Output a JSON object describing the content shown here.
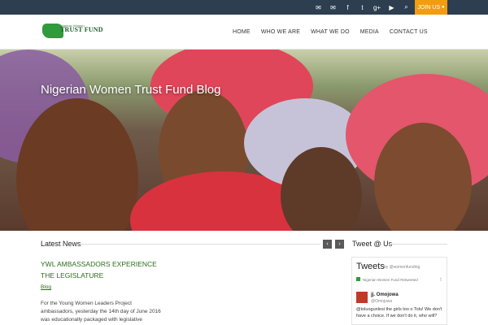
{
  "topbar": {
    "icons": [
      "envelope-icon",
      "envelope-icon",
      "facebook-icon",
      "twitter-icon",
      "googleplus-icon",
      "youtube-icon",
      "search-icon"
    ],
    "join_label": "JOIN US"
  },
  "header": {
    "logo_name": "TRUST FUND",
    "logo_sub": "Nigerian Women",
    "nav": [
      "HOME",
      "WHO WE ARE",
      "WHAT WE DO",
      "MEDIA",
      "CONTACT US"
    ]
  },
  "hero": {
    "title": "Nigerian Women Trust Fund Blog"
  },
  "news": {
    "title": "Latest News",
    "post_title": "YWL AMBASSADORS EXPERIENCE THE LEGISLATURE",
    "post_category": "Blog",
    "post_excerpt": "For the Young Women Leaders Project ambassadors, yesterday the 14th day of June 2016 was educationally packaged with legislative"
  },
  "tweets": {
    "section_title": "Tweet @ Us",
    "widget_title": "Tweets",
    "by": "by @womenfunding",
    "retweeted": "Nigerian Women Fund Retweeted",
    "user_name": "jj. Omojowa",
    "user_handle": "@Omojuwa",
    "text": "@toluogunlesi the girls too o Tolu! We don't have a choice. If we don't do it, who will?"
  },
  "colors": {
    "topbar": "#2c3e50",
    "accent": "#f39c12",
    "green": "#2c6e1a"
  }
}
